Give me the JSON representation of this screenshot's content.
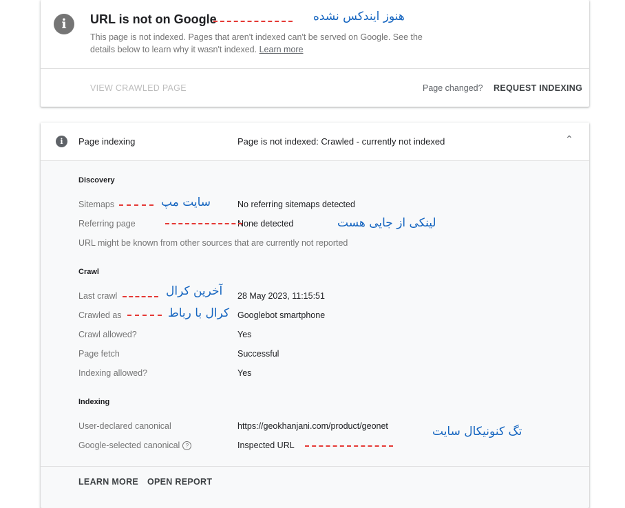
{
  "status_card": {
    "title": "URL is not on Google",
    "description": "This page is not indexed. Pages that aren't indexed can't be served on Google. See the details below to learn why it wasn't indexed.",
    "learn_more": "Learn more",
    "view_crawled_page": "VIEW CRAWLED PAGE",
    "page_changed": "Page changed?",
    "request_indexing": "REQUEST INDEXING"
  },
  "indexing_card": {
    "header_label": "Page indexing",
    "header_status": "Page is not indexed: Crawled - currently not indexed",
    "discovery": {
      "title": "Discovery",
      "sitemaps_label": "Sitemaps",
      "sitemaps_value": "No referring sitemaps detected",
      "referring_label": "Referring page",
      "referring_value": "None detected",
      "note": "URL might be known from other sources that are currently not reported"
    },
    "crawl": {
      "title": "Crawl",
      "last_crawl_label": "Last crawl",
      "last_crawl_value": "28 May 2023, 11:15:51",
      "crawled_as_label": "Crawled as",
      "crawled_as_value": "Googlebot smartphone",
      "crawl_allowed_label": "Crawl allowed?",
      "crawl_allowed_value": "Yes",
      "page_fetch_label": "Page fetch",
      "page_fetch_value": "Successful",
      "indexing_allowed_label": "Indexing allowed?",
      "indexing_allowed_value": "Yes"
    },
    "indexing": {
      "title": "Indexing",
      "user_canonical_label": "User-declared canonical",
      "user_canonical_value": "https://geokhanjani.com/product/geonet",
      "google_canonical_label": "Google-selected canonical",
      "google_canonical_value": "Inspected URL"
    },
    "learn_more_button": "LEARN MORE",
    "open_report_button": "OPEN REPORT"
  },
  "annotations": {
    "not_indexed": "هنوز ایندکس نشده",
    "sitemap": "سایت مپ",
    "link_from_elsewhere": "لینکی از جایی هست",
    "last_crawl": "آخرین کرال",
    "crawl_with_bot": "کرال با رباط",
    "canonical_tag": "تگ کنونیکال سایت"
  },
  "icons": {
    "info": "info-icon",
    "chevron": "chevron-up-icon",
    "help": "help-circle-icon"
  },
  "colors": {
    "annotation_text": "#1565c0",
    "annotation_dash": "#e53935"
  }
}
